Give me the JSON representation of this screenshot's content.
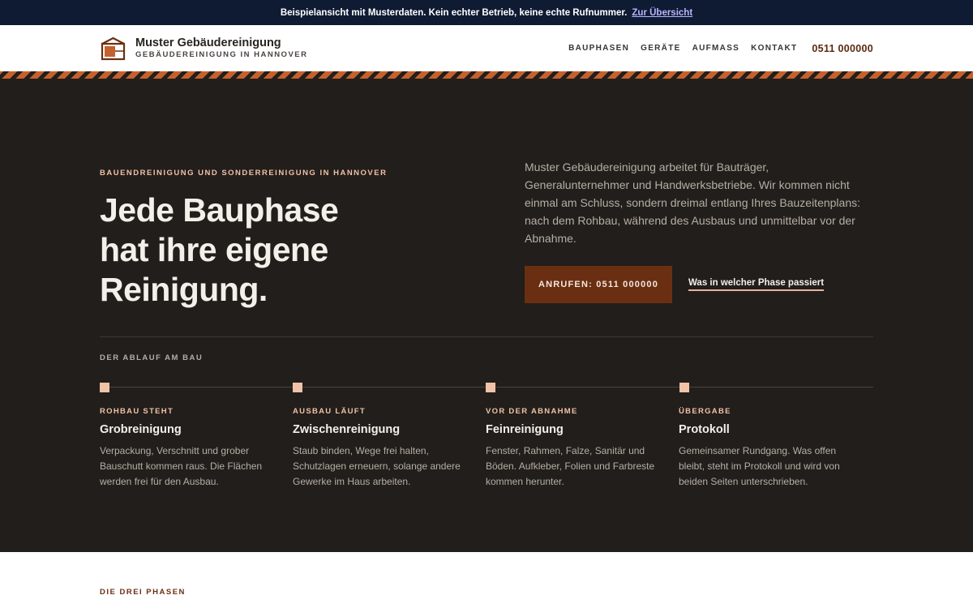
{
  "notice": {
    "message": "Beispielansicht mit Musterdaten. Kein echter Betrieb, keine echte Rufnummer.",
    "link": "Zur Übersicht"
  },
  "brand": {
    "name": "Muster Gebäudereinigung",
    "tagline": "GEBÄUDEREINIGUNG IN HANNOVER",
    "icon": "building-logo-icon"
  },
  "nav": {
    "items": [
      "BAUPHASEN",
      "GERÄTE",
      "AUFMASS",
      "KONTAKT"
    ],
    "phone": "0511 000000"
  },
  "hero": {
    "eyebrow": "BAUENDREINIGUNG UND SONDERREINIGUNG IN HANNOVER",
    "headline_lines": [
      "Jede Bauphase",
      "hat ihre eigene",
      "Reinigung."
    ],
    "intro": "Muster Gebäudereinigung arbeitet für Bauträger, Generalunternehmer und Handwerksbetriebe. Wir kommen nicht einmal am Schluss, sondern dreimal entlang Ihres Bauzeitenplans: nach dem Rohbau, während des Ausbaus und unmittelbar vor der Abnahme.",
    "cta_label": "ANRUFEN: 0511 000000",
    "secondary_link": "Was in welcher Phase passiert"
  },
  "process": {
    "label": "DER ABLAUF AM BAU",
    "steps": [
      {
        "kicker": "ROHBAU STEHT",
        "title": "Grobreinigung",
        "desc": "Verpackung, Verschnitt und grober Bauschutt kommen raus. Die Flächen werden frei für den Ausbau."
      },
      {
        "kicker": "AUSBAU LÄUFT",
        "title": "Zwischenreinigung",
        "desc": "Staub binden, Wege frei halten, Schutzlagen erneuern, solange andere Gewerke im Haus arbeiten."
      },
      {
        "kicker": "VOR DER ABNAHME",
        "title": "Feinreinigung",
        "desc": "Fenster, Rahmen, Falze, Sanitär und Böden. Aufkleber, Folien und Farbreste kommen herunter."
      },
      {
        "kicker": "ÜBERGABE",
        "title": "Protokoll",
        "desc": "Gemeinsamer Rundgang. Was offen bleibt, steht im Protokoll und wird von beiden Seiten unterschrieben."
      }
    ]
  },
  "phases": {
    "label": "DIE DREI PHASEN"
  },
  "colors": {
    "accent": "#6a2f13",
    "stripe": "#c5612c",
    "dark": "#221e1b",
    "highlight": "#f0c2a8"
  }
}
